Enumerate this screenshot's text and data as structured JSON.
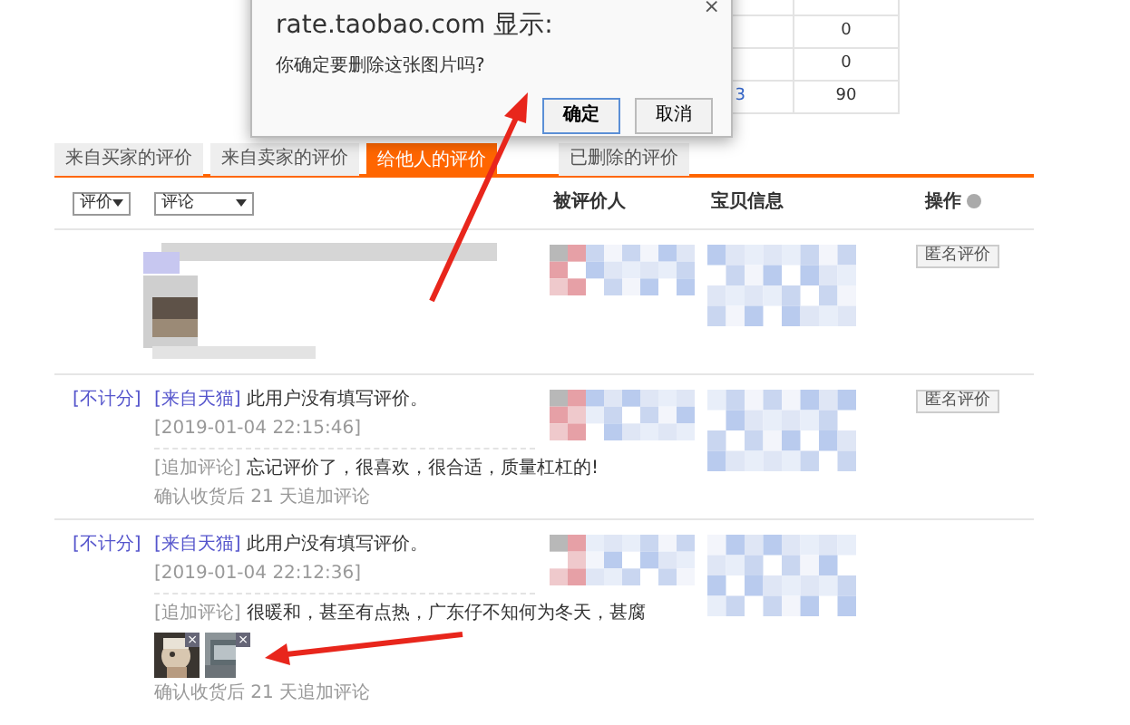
{
  "stats_table": {
    "rows": [
      {
        "column_2": "0"
      },
      {
        "column_2": "0"
      },
      {
        "column_1": "3",
        "column_2": "90"
      }
    ]
  },
  "dialog": {
    "title": "rate.taobao.com 显示:",
    "message": "你确定要删除这张图片吗?",
    "close": "×",
    "buttons": [
      {
        "label": "确定",
        "selected": true
      },
      {
        "label": "取消",
        "selected": false
      }
    ]
  },
  "tabs": [
    {
      "label": "来自买家的评价",
      "selected": false
    },
    {
      "label": "来自卖家的评价",
      "selected": false
    },
    {
      "label": "给他人的评价",
      "selected": true
    },
    {
      "label": "已删除的评价",
      "selected": false
    }
  ],
  "filters": [
    {
      "label": "评价"
    },
    {
      "label": "评论"
    }
  ],
  "columns": [
    "被评价人",
    "宝贝信息",
    "操作"
  ],
  "reviews": [
    {
      "kind": "blurred",
      "action": "匿名评价"
    },
    {
      "kind": "text",
      "score_note": "[不计分]",
      "source": "[来自天猫]",
      "text": "此用户没有填写评价。",
      "time": "[2019-01-04 22:15:46]",
      "followup_tag": "[追加评论]",
      "followup_text": "忘记评价了，很喜欢，很合适，质量杠杠的!",
      "followup_note": "确认收货后 21 天追加评论",
      "action": "匿名评价"
    },
    {
      "kind": "text",
      "score_note": "[不计分]",
      "source": "[来自天猫]",
      "text": "此用户没有填写评价。",
      "time": "[2019-01-04 22:12:36]",
      "followup_tag": "[追加评论]",
      "followup_text": "很暖和，甚至有点热，广东仔不知何为冬天，甚腐",
      "photos": [
        {
          "kind": "picture",
          "delete_mark": "×"
        },
        {
          "kind": "picture",
          "delete_mark": "×"
        }
      ],
      "followup_note": "确认收货后 21 天追加评论"
    }
  ]
}
